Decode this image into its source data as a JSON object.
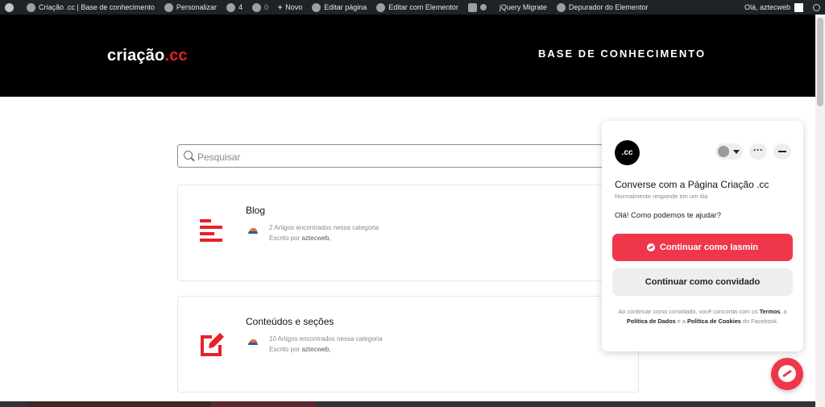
{
  "admin_bar": {
    "site_name": "Criação .cc | Base de conhecimento",
    "customize": "Personalizar",
    "updates_count": "4",
    "comments_count": "0",
    "new": "Novo",
    "edit_page": "Editar página",
    "edit_elementor": "Editar com Elementor",
    "jquery_migrate": "jQuery Migrate",
    "debugger": "Depurador do Elementor",
    "greeting": "Olá, aztecweb"
  },
  "header": {
    "logo_text": "criação",
    "logo_suffix": ".cc",
    "title": "BASE DE CONHECIMENTO"
  },
  "search": {
    "placeholder": "Pesquisar"
  },
  "categories": [
    {
      "title": "Blog",
      "count_text": "2 Artigos encontrados nessa categoria",
      "by": "Escrito por",
      "author": "aztecweb,",
      "icon": "list-icon"
    },
    {
      "title": "Conteúdos e seções",
      "count_text": "10 Artigos encontrados nessa categoria",
      "by": "Escrito por",
      "author": "aztecweb,",
      "icon": "edit-icon"
    }
  ],
  "chat": {
    "avatar_text": ".cc",
    "title": "Converse com a Página Criação .cc",
    "subtitle": "Normalmente responde em um dia",
    "greeting": "Olá! Como podemos te ajudar?",
    "continue_as": "Continuar como Iasmin",
    "continue_guest": "Continuar como convidado",
    "terms_pre": "Ao continuar como convidado, você concorda com os",
    "terms_link": "Termos",
    "terms_mid": ", a",
    "data_policy": "Política de Dados",
    "terms_and": "e a",
    "cookie_policy": "Política de Cookies",
    "terms_post": "do Facebook."
  },
  "colors": {
    "accent": "#f0364a",
    "brand_red": "#e8202a",
    "header_bg": "#000000",
    "admin_bg": "#1d2327"
  }
}
